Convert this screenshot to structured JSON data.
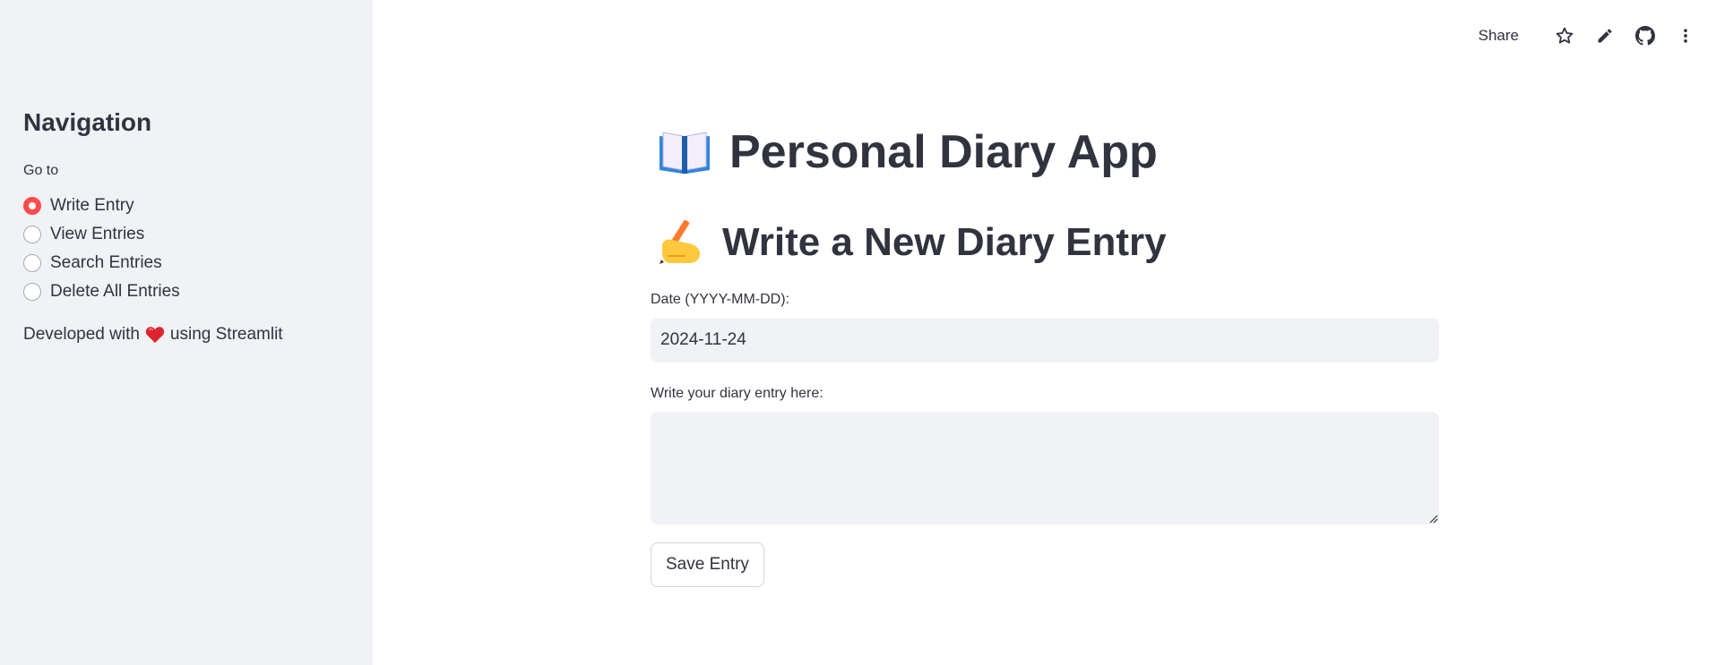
{
  "sidebar": {
    "title": "Navigation",
    "radio_label": "Go to",
    "options": [
      {
        "label": "Write Entry",
        "selected": true
      },
      {
        "label": "View Entries",
        "selected": false
      },
      {
        "label": "Search Entries",
        "selected": false
      },
      {
        "label": "Delete All Entries",
        "selected": false
      }
    ],
    "footer_before": "Developed with",
    "footer_after": "using Streamlit"
  },
  "toolbar": {
    "share_label": "Share",
    "icons": [
      "star-icon",
      "pencil-icon",
      "github-icon",
      "kebab-menu-icon"
    ]
  },
  "main": {
    "title": "Personal Diary App",
    "subheader": "Write a New Diary Entry",
    "date_label": "Date (YYYY-MM-DD):",
    "date_value": "2024-11-24",
    "entry_label": "Write your diary entry here:",
    "entry_value": "",
    "save_label": "Save Entry"
  },
  "colors": {
    "accent": "#ff4b4b",
    "sidebar_bg": "#f0f2f6",
    "text": "#31333f",
    "input_bg": "#f0f2f6"
  }
}
